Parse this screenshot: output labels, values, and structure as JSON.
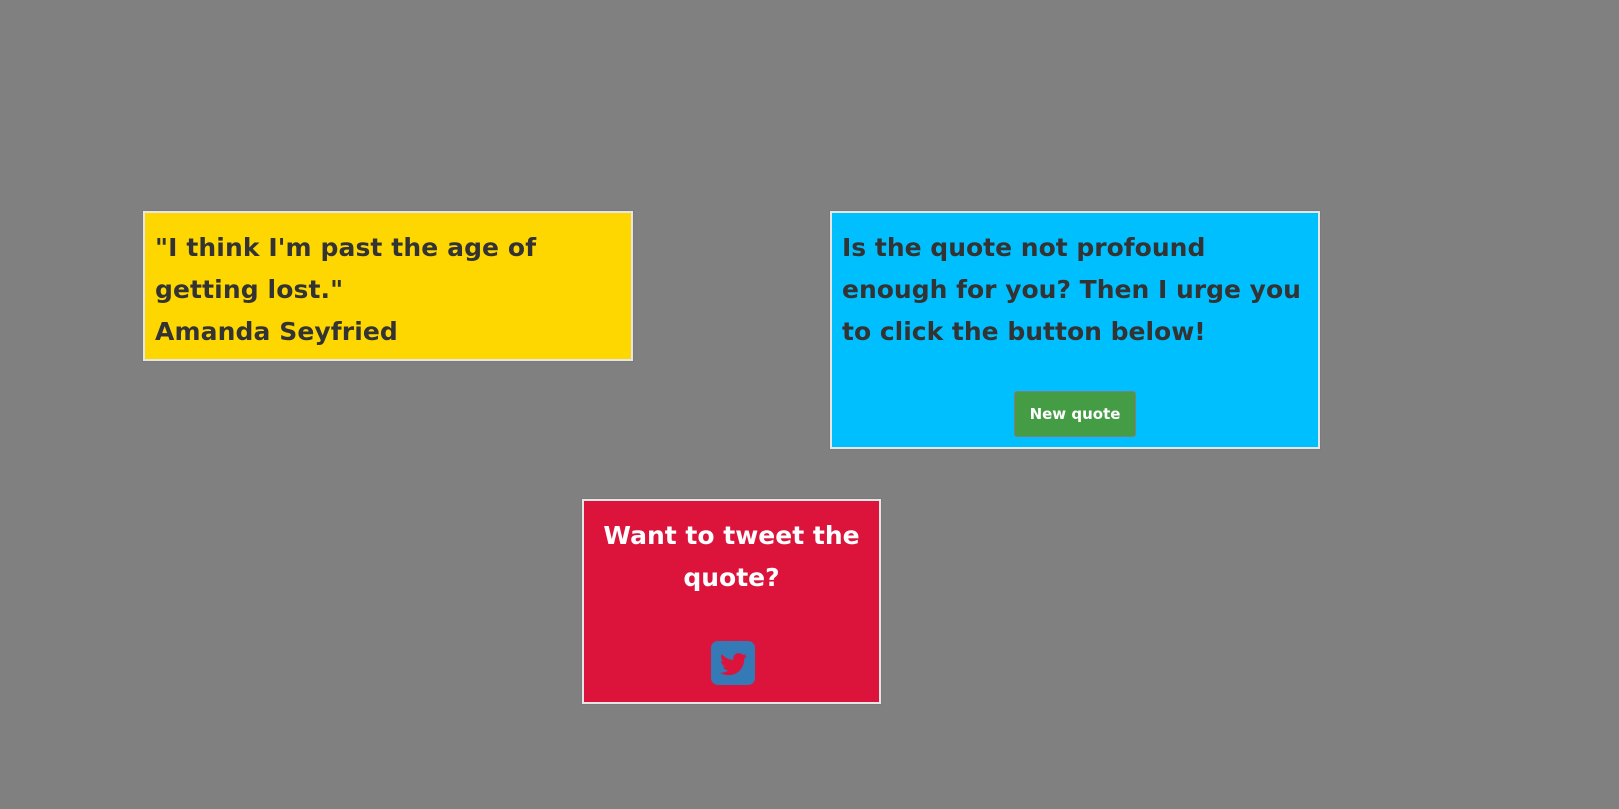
{
  "quote": {
    "text": "\"I think I'm past the age of getting lost.\"",
    "author": "Amanda Seyfried"
  },
  "prompt": {
    "text": "Is the quote not profound enough for you? Then I urge you to click the button below!",
    "button_label": "New quote"
  },
  "tweet": {
    "title": "Want to tweet the quote?",
    "icon": "twitter-icon"
  },
  "colors": {
    "background": "#808080",
    "quote_card": "#ffd700",
    "prompt_card": "#00bfff",
    "tweet_card": "#dc143c",
    "button": "#449d44",
    "twitter_button": "#337ab7"
  }
}
